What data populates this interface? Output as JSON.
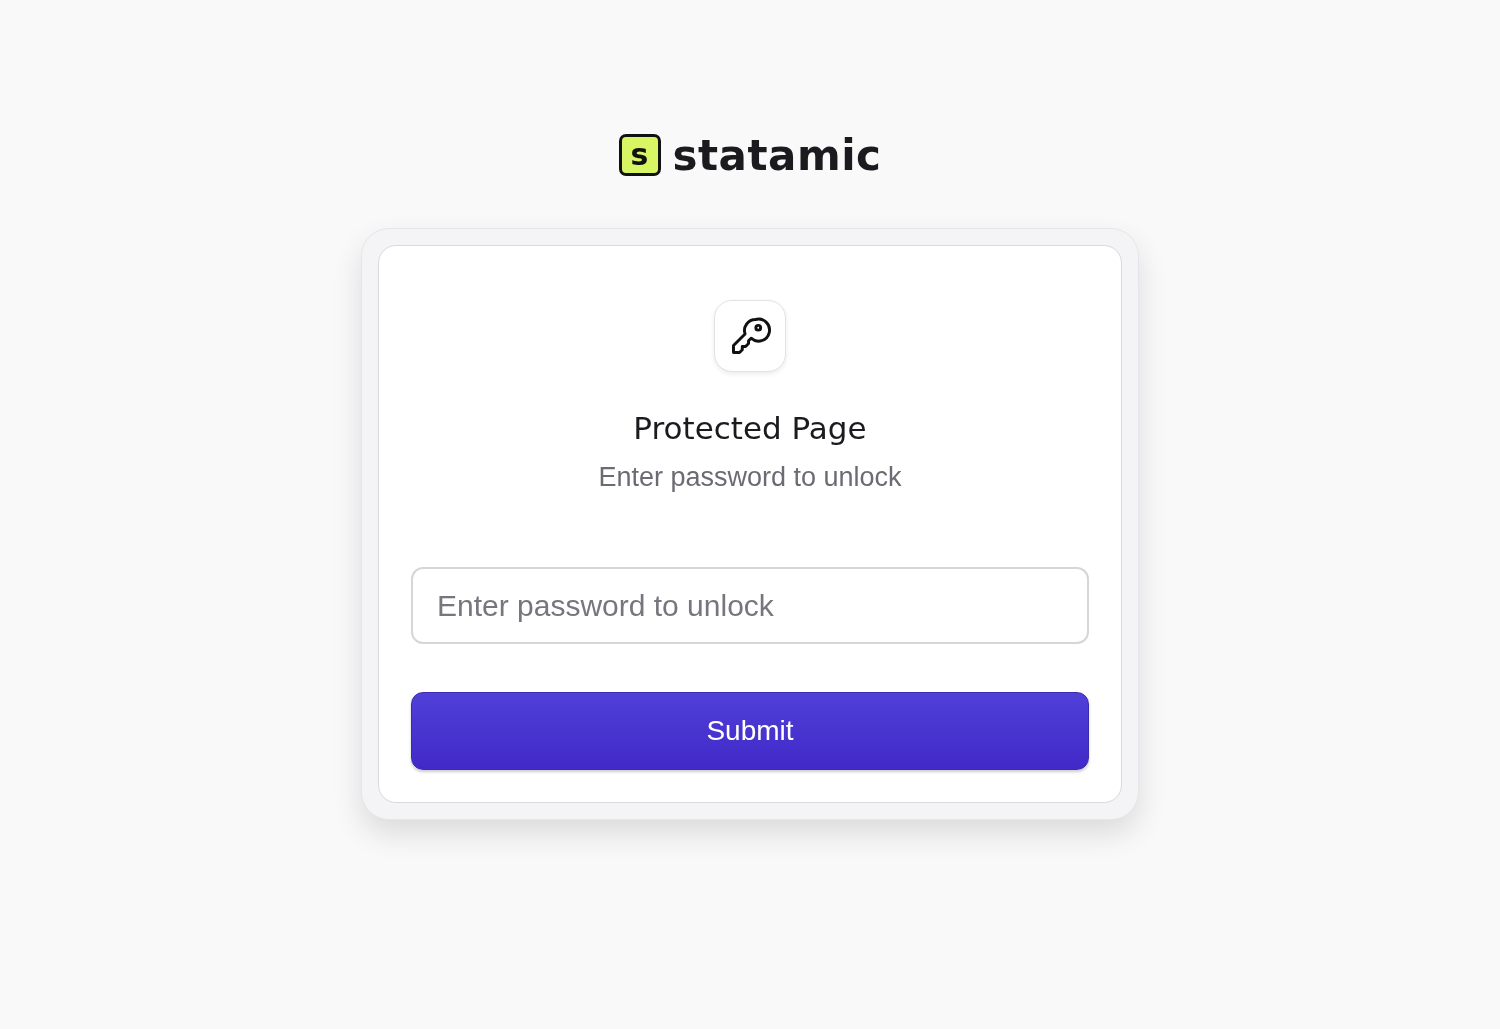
{
  "logo": {
    "mark": "s",
    "wordmark": "statamic"
  },
  "card": {
    "title": "Protected Page",
    "subtitle": "Enter password to unlock",
    "password_field": {
      "placeholder": "Enter password to unlock"
    },
    "submit_button": {
      "label": "Submit"
    }
  }
}
